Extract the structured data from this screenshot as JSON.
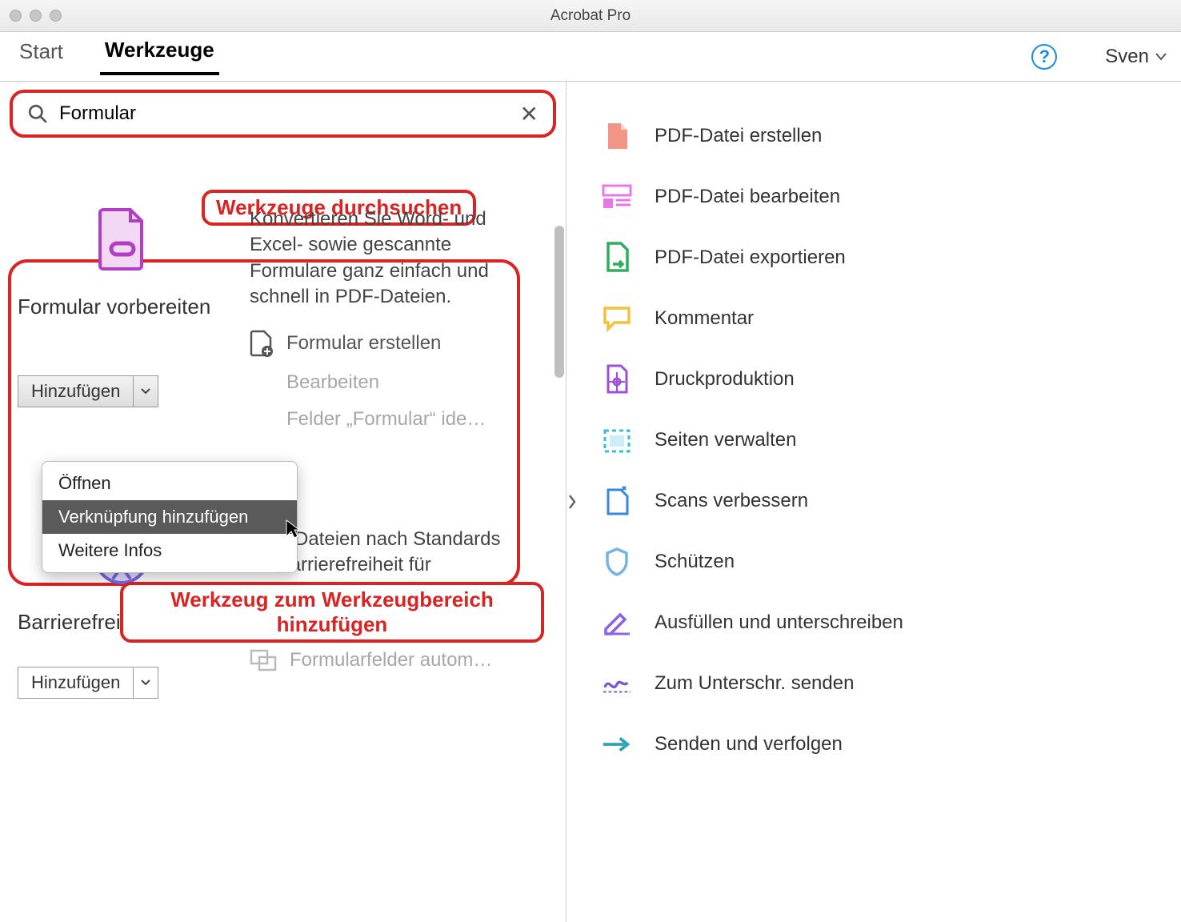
{
  "window": {
    "title": "Acrobat Pro"
  },
  "tabs": {
    "start": "Start",
    "tools": "Werkzeuge"
  },
  "user": {
    "name": "Sven"
  },
  "search": {
    "value": "Formular"
  },
  "annotations": {
    "search_label": "Werkzeuge durchsuchen",
    "add_label": "Werkzeug zum Werkzeugbereich hinzufügen"
  },
  "card1": {
    "title": "Formular vorbereiten",
    "desc": "Konvertieren Sie Word- und Excel- sowie gescannte Formulare ganz einfach und schnell in PDF-Dateien.",
    "add_button": "Hinzufügen",
    "actions": {
      "create": "Formular erstellen",
      "edit": "Bearbeiten",
      "identify": "Felder „Formular“ ide…"
    },
    "menu": {
      "open": "Öffnen",
      "shortcut": "Verknüpfung hinzufügen",
      "more": "Weitere Infos"
    }
  },
  "card2": {
    "title": "Barrierefreiheit",
    "desc": "PDF-Dateien nach Standards für Barrierefreiheit für Menschen mit Behinderungen erstellen und überprüfen",
    "add_button": "Hinzufügen",
    "action_auto": "Formularfelder autom…"
  },
  "right_tools": [
    {
      "id": "create",
      "label": "PDF-Datei erstellen",
      "color": "#f08b7a"
    },
    {
      "id": "edit",
      "label": "PDF-Datei bearbeiten",
      "color": "#e679e6"
    },
    {
      "id": "export",
      "label": "PDF-Datei exportieren",
      "color": "#2fae60"
    },
    {
      "id": "comment",
      "label": "Kommentar",
      "color": "#f2c23b"
    },
    {
      "id": "print",
      "label": "Druckproduktion",
      "color": "#a04fd6"
    },
    {
      "id": "pages",
      "label": "Seiten verwalten",
      "color": "#34bfe0"
    },
    {
      "id": "scan",
      "label": "Scans verbessern",
      "color": "#3a86d8"
    },
    {
      "id": "protect",
      "label": "Schützen",
      "color": "#74b3e2"
    },
    {
      "id": "fill",
      "label": "Ausfüllen und unterschreiben",
      "color": "#8c63e5"
    },
    {
      "id": "sendsign",
      "label": "Zum Unterschr. senden",
      "color": "#7a57d1"
    },
    {
      "id": "sendtrack",
      "label": "Senden und verfolgen",
      "color": "#2fa3b5"
    }
  ]
}
